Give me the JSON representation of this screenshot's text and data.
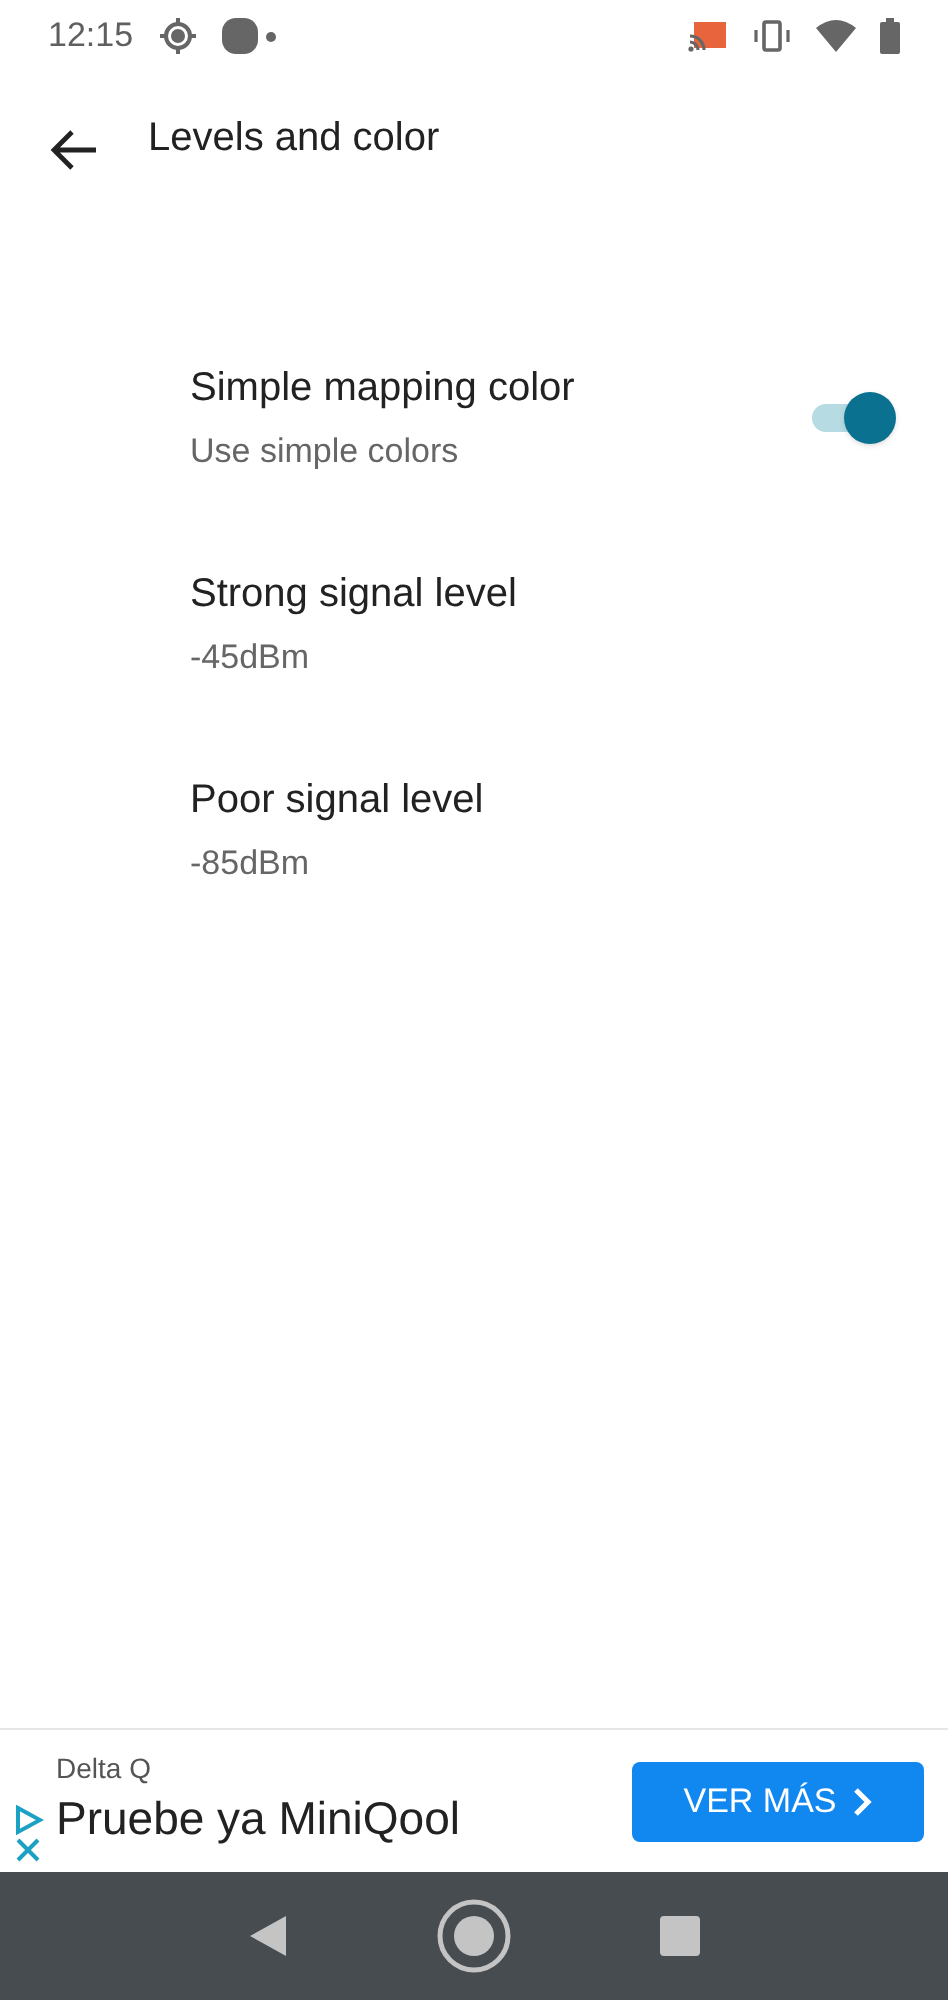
{
  "status_bar": {
    "time": "12:15"
  },
  "toolbar": {
    "title": "Levels and color"
  },
  "settings": [
    {
      "kind": "switch",
      "title": "Simple mapping color",
      "summary": "Use simple colors",
      "on": true
    },
    {
      "kind": "plain",
      "title": "Strong signal level",
      "summary": "-45dBm"
    },
    {
      "kind": "plain",
      "title": "Poor signal level",
      "summary": "-85dBm"
    }
  ],
  "ad": {
    "advertiser": "Delta Q",
    "headline": "Pruebe ya MiniQool",
    "button": "VER MÁS"
  }
}
